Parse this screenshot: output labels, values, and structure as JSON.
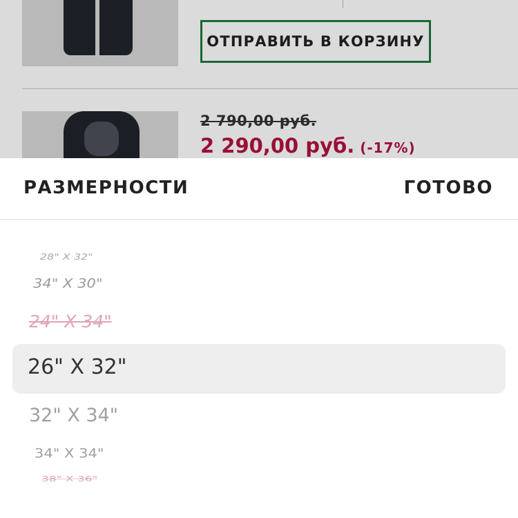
{
  "product_list": {
    "cart_button_label": "ОТПРАВИТЬ В КОРЗИНУ",
    "item2": {
      "old_price": "2 790,00 руб.",
      "new_price": "2 290,00 руб.",
      "discount": "(-17%)"
    }
  },
  "picker": {
    "title": "РАЗМЕРНОСТИ",
    "done_label": "ГОТОВО",
    "options": [
      {
        "label": "28\" X 32\"",
        "available": true
      },
      {
        "label": "34\" X 30\"",
        "available": true
      },
      {
        "label": "24\" X 34\"",
        "available": false
      },
      {
        "label": "26\" X 32\"",
        "available": true,
        "selected": true
      },
      {
        "label": "32\" X 34\"",
        "available": true
      },
      {
        "label": "34\" X 34\"",
        "available": true
      },
      {
        "label": "38\" X 36\"",
        "available": false
      }
    ]
  },
  "colors": {
    "accent_green": "#1d7a3c",
    "price_red": "#b3123f",
    "unavailable_pink": "#e0a3b4"
  }
}
